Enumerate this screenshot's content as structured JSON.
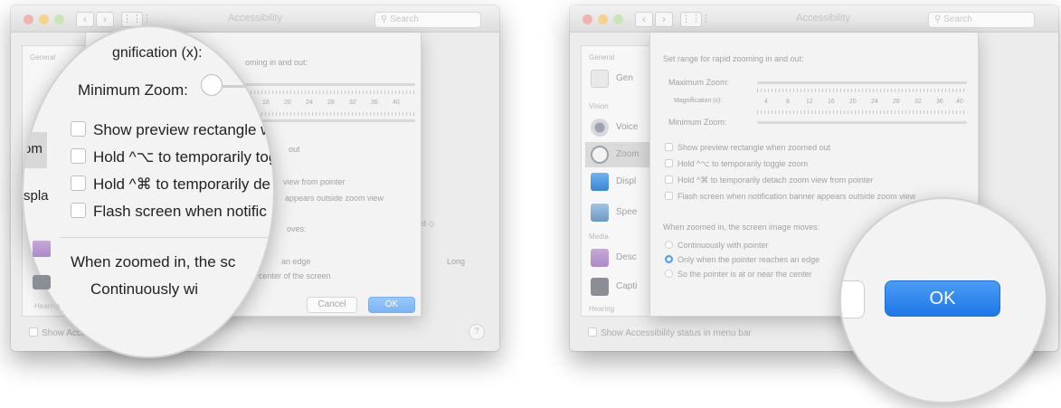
{
  "window": {
    "title": "Accessibility",
    "search_placeholder": "Search",
    "status_label": "Show Accessibility status in menu bar",
    "help_label": "?"
  },
  "sidebar": {
    "general_header": "General",
    "vision_header": "Vision",
    "media_header": "Media",
    "hearing_header": "Hearing",
    "items": [
      {
        "label": "General",
        "icon": "general-icon"
      },
      {
        "label": "VoiceOver",
        "icon": "voiceover-icon"
      },
      {
        "label": "Zoom",
        "icon": "zoom-icon"
      },
      {
        "label": "Display",
        "icon": "display-icon"
      },
      {
        "label": "Speech",
        "icon": "speech-icon"
      },
      {
        "label": "Descriptions",
        "icon": "descriptions-icon"
      },
      {
        "label": "Captions",
        "icon": "captions-icon"
      }
    ],
    "left_visible": [
      "Gen",
      "Voice",
      "Zoom",
      "Displ",
      "Spee",
      "Desc",
      "Capti"
    ]
  },
  "sheet": {
    "range_text": "Set range for rapid zooming in and out:",
    "left_range_fragment": "oming in and out:",
    "max_zoom_label": "Maximum Zoom:",
    "magnification_label": "Magnification (x):",
    "min_zoom_label": "Minimum Zoom:",
    "scale": [
      "4",
      "8",
      "12",
      "16",
      "20",
      "24",
      "28",
      "32",
      "36",
      "40"
    ],
    "left_scale": [
      "16",
      "20",
      "24",
      "28",
      "32",
      "36",
      "40"
    ],
    "checkboxes": [
      "Show preview rectangle when zoomed out",
      "Hold ^⌥ to temporarily toggle zoom",
      "Hold ^⌘ to temporarily detach zoom view from pointer",
      "Flash screen when notification banner appears outside zoom view"
    ],
    "left_fragments": {
      "preview_tail": "out",
      "detach_tail": "view from pointer",
      "flash_tail": "appears outside zoom view",
      "moves_tail": "oves:",
      "edge_tail": "an edge",
      "center_tail": "the center of the screen",
      "bg_value": "d",
      "bg_long": "Long"
    },
    "moves_label": "When zoomed in, the screen image moves:",
    "radios": [
      "Continuously with pointer",
      "Only when the pointer reaches an edge",
      "So the pointer is at or near the center"
    ],
    "cancel_label": "Cancel",
    "ok_label": "OK"
  },
  "left_lens": {
    "magnification_fragment": "gnification (x):",
    "min_zoom": "Minimum Zoom:",
    "preview": "Show preview rectangle w",
    "toggle": "Hold ^⌥ to temporarily tog",
    "detach": "Hold ^⌘ to temporarily de",
    "flash": "Flash screen when notific",
    "moves": "When zoomed in, the sc",
    "continuous": "Continuously wi",
    "side_zoom": "om",
    "side_display": "spla"
  },
  "right_lens": {
    "ok_label": "OK"
  },
  "colors": {
    "accent": "#4da0f0",
    "ok_big": "#1f78e8"
  }
}
